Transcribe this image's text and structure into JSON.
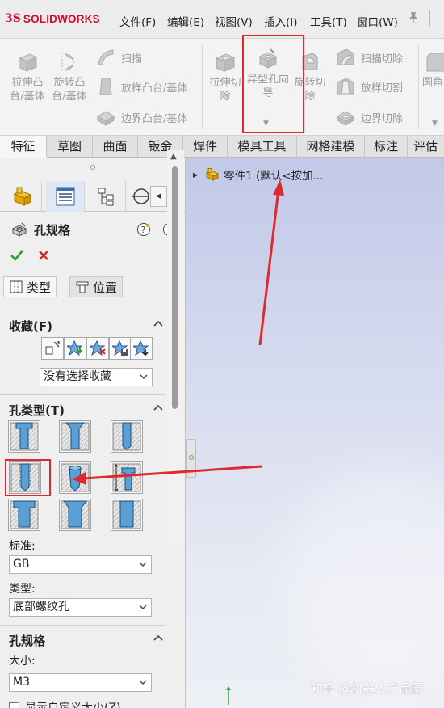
{
  "app": {
    "logo_ds": "3S",
    "logo_name": "SOLIDWORKS"
  },
  "menu": [
    {
      "label": "文件(F)"
    },
    {
      "label": "编辑(E)"
    },
    {
      "label": "视图(V)"
    },
    {
      "label": "插入(I)"
    },
    {
      "label": "工具(T)"
    },
    {
      "label": "窗口(W)"
    }
  ],
  "ribbon": {
    "extruded_boss": "拉伸凸台/基体",
    "revolved_boss": "旋转凸台/基体",
    "sweep": "扫描",
    "loft_boss": "放样凸台/基体",
    "boundary_boss": "边界凸台/基体",
    "extruded_cut": "拉伸切除",
    "hole_wizard": "异型孔向导",
    "revolved_cut": "旋转切除",
    "swept_cut": "扫描切除",
    "lofted_cut": "放样切割",
    "boundary_cut": "边界切除",
    "fillet": "圆角"
  },
  "tabs": [
    {
      "label": "特征",
      "active": true
    },
    {
      "label": "草图"
    },
    {
      "label": "曲面"
    },
    {
      "label": "钣金"
    },
    {
      "label": "焊件"
    },
    {
      "label": "模具工具"
    },
    {
      "label": "网格建模"
    },
    {
      "label": "标注"
    },
    {
      "label": "评估"
    }
  ],
  "property_manager": {
    "title": "孔规格",
    "subtabs": {
      "type": "类型",
      "position": "位置"
    },
    "favorites": {
      "heading": "收藏(F)",
      "dropdown_value": "没有选择收藏"
    },
    "hole_type": {
      "heading": "孔类型(T)",
      "standard_label": "标准:",
      "standard_value": "GB",
      "type_label": "类型:",
      "type_value": "底部螺纹孔"
    },
    "hole_spec": {
      "heading": "孔规格",
      "size_label": "大小:",
      "size_value": "M3",
      "custom_size_label": "显示自定义大小(Z)"
    }
  },
  "feature_tree": {
    "part": "零件1  (默认<按加..."
  },
  "watermark": "知乎 @机器人产品圈",
  "colors": {
    "highlight": "#e0282d",
    "brand": "#c8102e"
  }
}
